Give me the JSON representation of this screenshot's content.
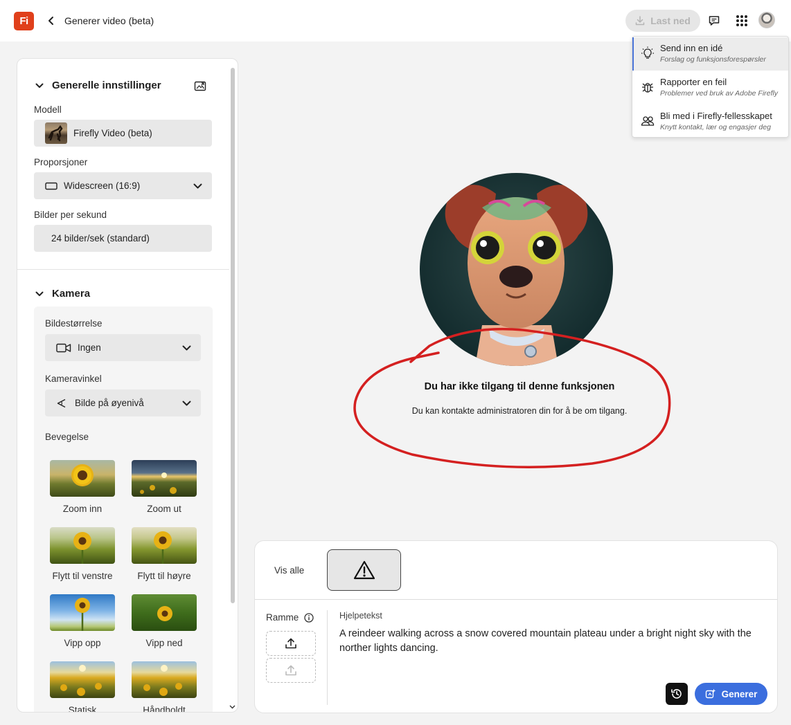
{
  "header": {
    "logo_text": "Fi",
    "title": "Generer video (beta)",
    "download_label": "Last ned"
  },
  "menu": {
    "items": [
      {
        "title": "Send inn en idé",
        "subtitle": "Forslag og funksjonsforespørsler"
      },
      {
        "title": "Rapporter en feil",
        "subtitle": "Problemer ved bruk av Adobe Firefly"
      },
      {
        "title": "Bli med i Firefly-fellesskapet",
        "subtitle": "Knytt kontakt, lær og engasjer deg"
      }
    ]
  },
  "settings": {
    "general_title": "Generelle innstillinger",
    "model_label": "Modell",
    "model_value": "Firefly Video (beta)",
    "aspect_label": "Proporsjoner",
    "aspect_value": "Widescreen (16:9)",
    "fps_label": "Bilder per sekund",
    "fps_value": "24 bilder/sek (standard)",
    "camera_title": "Kamera",
    "shot_size_label": "Bildestørrelse",
    "shot_size_value": "Ingen",
    "camera_angle_label": "Kameravinkel",
    "camera_angle_value": "Bilde på øyenivå",
    "motion_label": "Bevegelse",
    "motion_items": [
      "Zoom inn",
      "Zoom ut",
      "Flytt til venstre",
      "Flytt til høyre",
      "Vipp opp",
      "Vipp ned",
      "Statisk",
      "Håndholdt"
    ]
  },
  "notice": {
    "title": "Du har ikke tilgang til denne funksjonen",
    "text": "Du kan kontakte administratoren din for å be om tilgang."
  },
  "prompt": {
    "show_all": "Vis alle",
    "frame_label": "Ramme",
    "help_label": "Hjelpetekst",
    "text": "A reindeer walking across a snow covered mountain plateau under a bright night sky with the norther lights dancing.",
    "generate_label": "Generer"
  },
  "colors": {
    "brand": "#e0401b",
    "accent": "#3b6ede",
    "annotation": "#d42020"
  }
}
